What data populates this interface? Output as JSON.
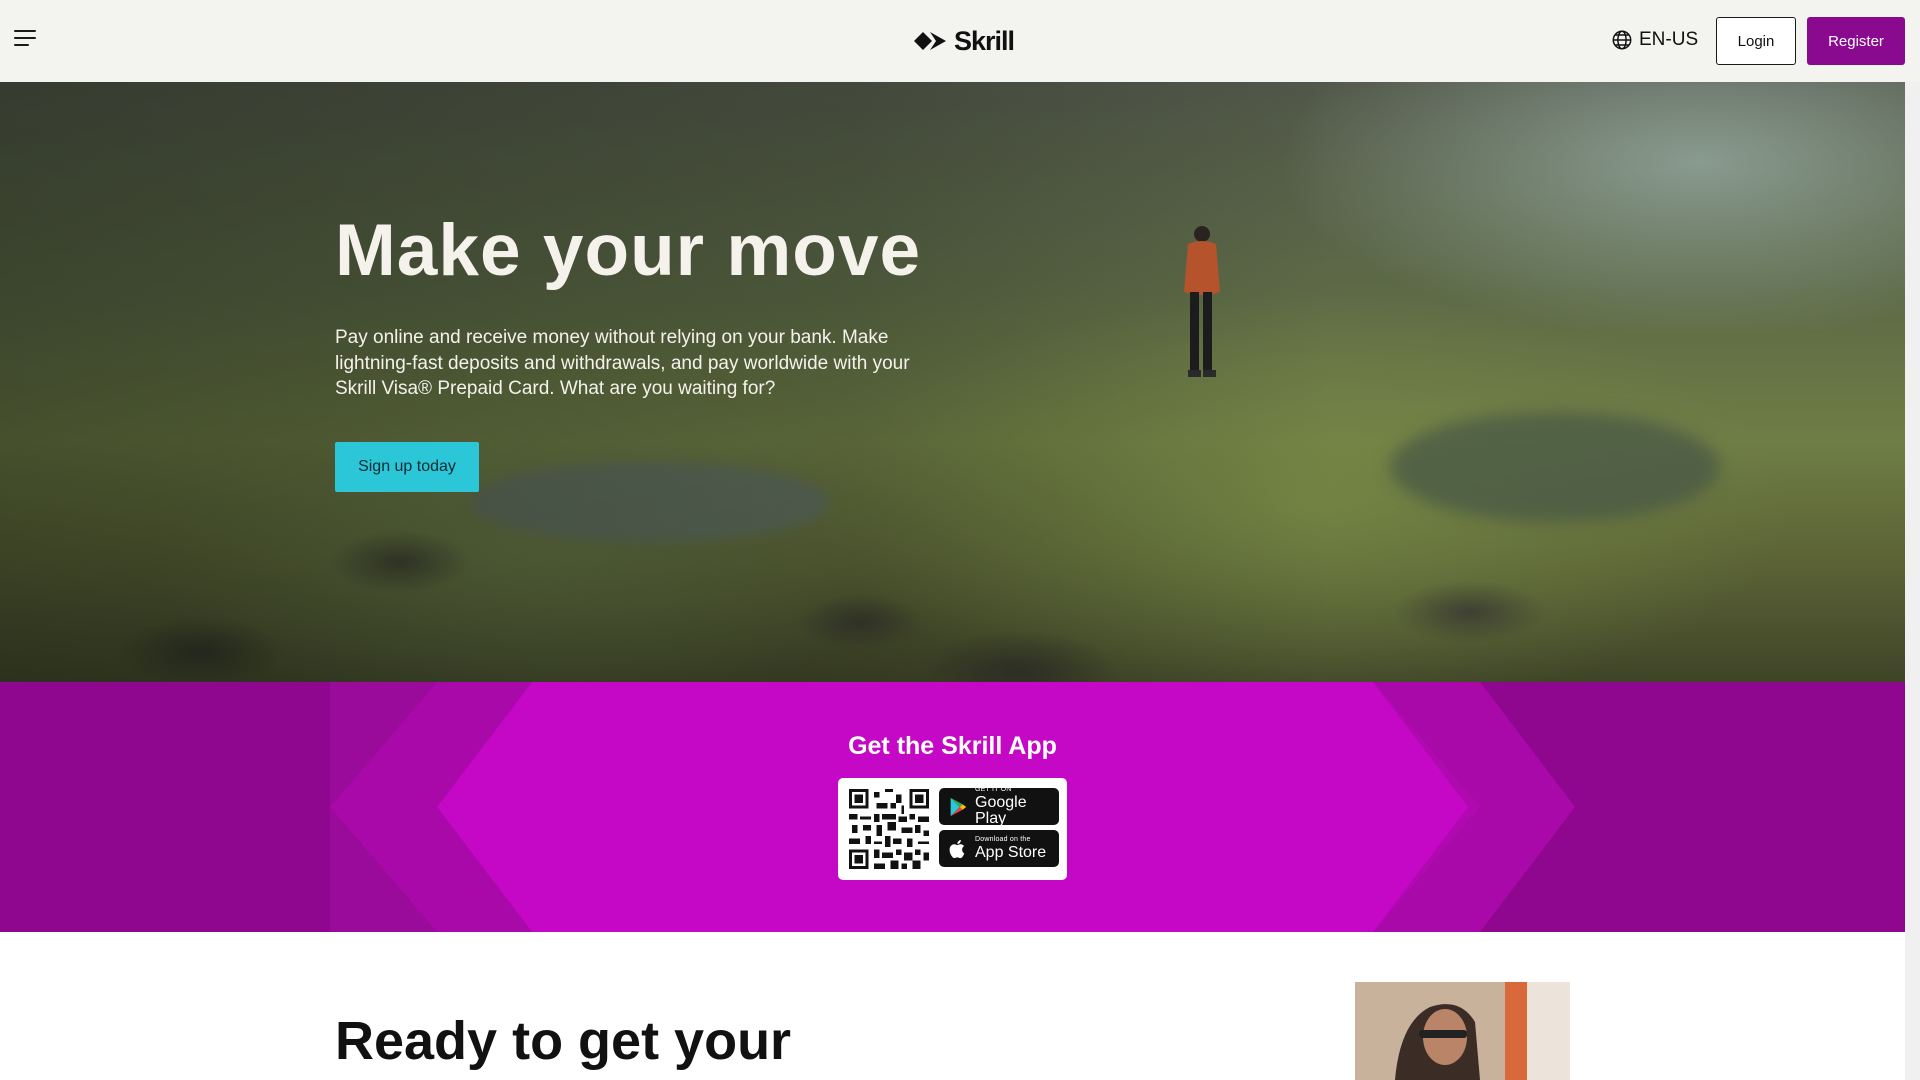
{
  "header": {
    "logo_text": "Skrill",
    "language": "EN-US",
    "login_label": "Login",
    "register_label": "Register"
  },
  "hero": {
    "title": "Make your move",
    "description": "Pay online and receive money without relying on your bank. Make lightning-fast deposits and withdrawals, and pay worldwide with your Skrill Visa® Prepaid Card. What are you waiting for?",
    "cta_label": "Sign up today"
  },
  "app_band": {
    "title": "Get the Skrill App",
    "google_play": {
      "small": "GET IT ON",
      "big": "Google Play"
    },
    "app_store": {
      "small": "Download on the",
      "big": "App Store"
    }
  },
  "section": {
    "title": "Ready to get your"
  },
  "colors": {
    "brand_purple": "#8a0a8f",
    "band_magenta": "#c508c5",
    "cta_cyan": "#2bc6d8",
    "header_bg": "#f3f3ef"
  }
}
